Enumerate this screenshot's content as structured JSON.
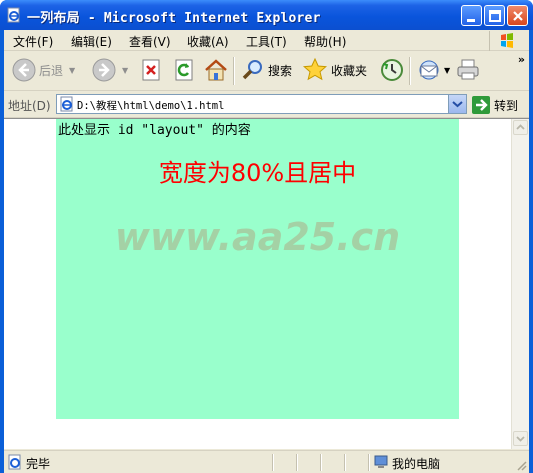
{
  "window": {
    "title": "一列布局 - Microsoft Internet Explorer"
  },
  "menu": {
    "items": [
      "文件(F)",
      "编辑(E)",
      "查看(V)",
      "收藏(A)",
      "工具(T)",
      "帮助(H)"
    ]
  },
  "toolbar": {
    "back_label": "后退",
    "search_label": "搜索",
    "favorites_label": "收藏夹",
    "more": "»"
  },
  "address": {
    "label": "地址(D)",
    "url": "D:\\教程\\html\\demo\\1.html",
    "go_label": "转到"
  },
  "page": {
    "layout_text": "此处显示 id \"layout\" 的内容",
    "heading": "宽度为80%且居中",
    "watermark": "www.aa25.cn",
    "layout_color": "#99ffcc",
    "heading_color": "#ff0000"
  },
  "status": {
    "text": "完毕",
    "zone": "我的电脑"
  }
}
